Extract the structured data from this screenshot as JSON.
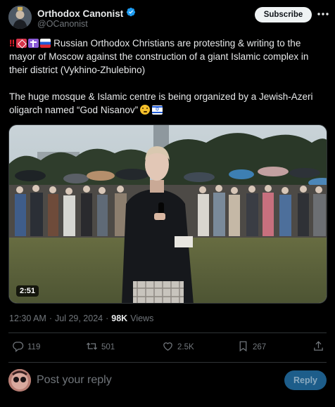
{
  "author": {
    "display_name": "Orthodox Canonist",
    "handle": "@OCanonist",
    "verified": true
  },
  "header": {
    "subscribe_label": "Subscribe",
    "more_icon": "ellipsis-icon"
  },
  "post": {
    "lead_emojis": [
      "double-exclamation-emoji",
      "red-cross-emoji",
      "orthodox-cross-emoji",
      "russia-flag-emoji"
    ],
    "paragraph1": "Russian Orthodox Christians are protesting & writing to the mayor of Moscow against the construction of a giant Islamic complex in their district (Vykhino-Zhulebino)",
    "paragraph2": "The huge mosque & Islamic centre is being organized by a Jewish-Azeri oligarch named “God Nisanov”",
    "trailing_emojis": [
      "face-with-raised-eyebrow-emoji",
      "israel-flag-emoji"
    ]
  },
  "video": {
    "duration": "2:51"
  },
  "meta": {
    "time": "12:30 AM",
    "separator": "·",
    "date": "Jul 29, 2024",
    "dot": "·",
    "views_count": "98K",
    "views_label": "Views"
  },
  "actions": {
    "replies": "119",
    "reposts": "501",
    "likes": "2.5K",
    "bookmarks": "267"
  },
  "reply": {
    "placeholder": "Post your reply",
    "button_label": "Reply"
  },
  "colors": {
    "background": "#000000",
    "text": "#e7e9ea",
    "muted": "#71767b",
    "verified": "#1d9bf0",
    "reply_button": "#1d5d8a"
  }
}
